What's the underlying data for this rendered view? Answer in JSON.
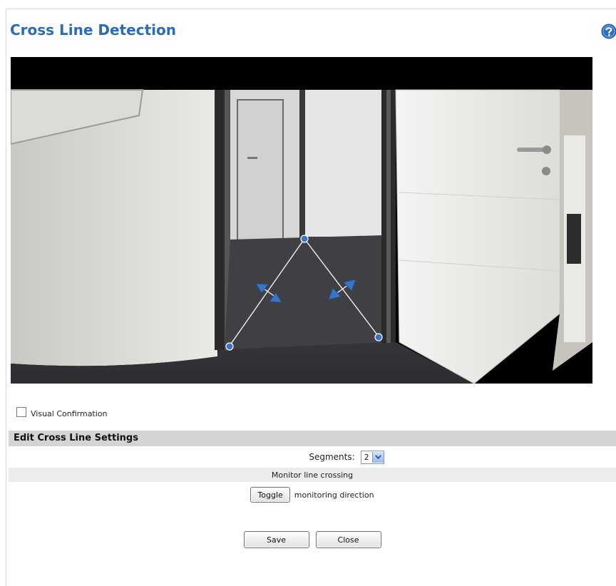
{
  "page": {
    "title": "Cross Line Detection",
    "help_icon": "help-icon"
  },
  "video": {
    "description_icon": "camera-feed"
  },
  "visual_confirmation": {
    "label": "Visual Confirmation",
    "checked": false
  },
  "settings": {
    "header": "Edit Cross Line Settings",
    "segments_label": "Segments:",
    "segments_value": "2",
    "monitor_text": "Monitor line crossing",
    "toggle_label": "Toggle",
    "toggle_suffix": "monitoring direction",
    "save_label": "Save",
    "close_label": "Close"
  },
  "colors": {
    "accent": "#2a6db5",
    "line_handle": "#3a74c4"
  }
}
